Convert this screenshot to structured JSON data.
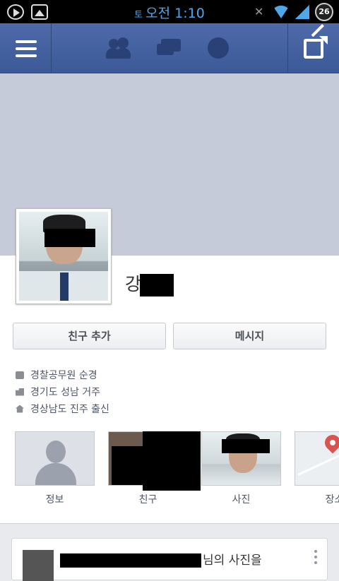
{
  "status_bar": {
    "day": "토",
    "time": "오전 1:10",
    "battery": "26"
  },
  "profile": {
    "name": "강",
    "add_friend_label": "친구 추가",
    "message_label": "메시지",
    "info": [
      {
        "icon": "briefcase-icon",
        "text": "경찰공무원 순경"
      },
      {
        "icon": "city-icon",
        "text": "경기도 성남 거주"
      },
      {
        "icon": "home-icon",
        "text": "경상남도 진주 출신"
      }
    ],
    "tiles": [
      {
        "label": "정보"
      },
      {
        "label": "친구"
      },
      {
        "label": "사진"
      },
      {
        "label": "장소"
      }
    ]
  },
  "feed": {
    "text": "님의 사진을"
  },
  "colors": {
    "nav_blue": "#3b5998",
    "cover_gray": "#c5cbd9",
    "status_blue": "#4ea7e8"
  }
}
